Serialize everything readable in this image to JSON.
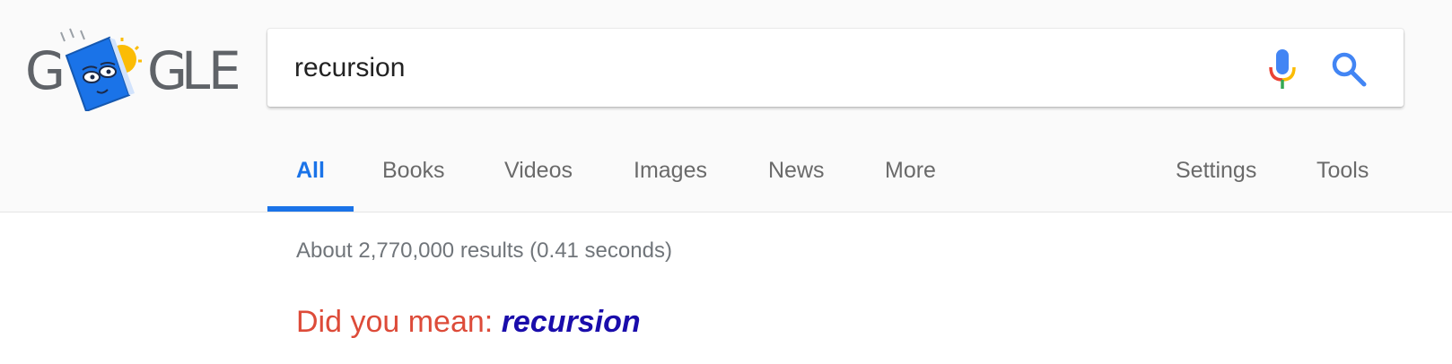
{
  "logo": {
    "letters": [
      "G",
      "G",
      "L",
      "E"
    ],
    "icon": "doodle-book-sun-icon",
    "colors": {
      "book": "#1a73e8",
      "sun": "#fbbc05",
      "text": "#5f6368"
    }
  },
  "search": {
    "query": "recursion",
    "mic_icon": "microphone-icon",
    "search_icon": "search-icon"
  },
  "tabs": [
    {
      "label": "All",
      "active": true
    },
    {
      "label": "Books",
      "active": false
    },
    {
      "label": "Videos",
      "active": false
    },
    {
      "label": "Images",
      "active": false
    },
    {
      "label": "News",
      "active": false
    },
    {
      "label": "More",
      "active": false
    },
    {
      "label": "Settings",
      "active": false
    },
    {
      "label": "Tools",
      "active": false
    }
  ],
  "results": {
    "stats": "About 2,770,000 results (0.41 seconds)",
    "did_you_mean_label": "Did you mean:",
    "did_you_mean_suggestion": "recursion"
  },
  "colors": {
    "accent": "#1a73e8",
    "did_you_mean": "#dd4b39",
    "link": "#1a0dab",
    "tab_text": "#6a6a6a",
    "stats_text": "#70757a"
  }
}
